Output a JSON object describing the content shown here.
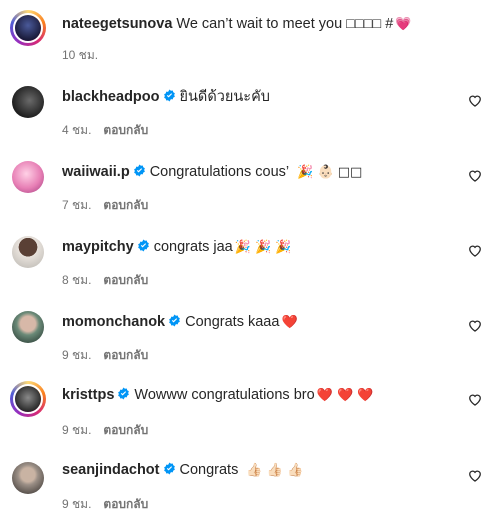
{
  "comments": [
    {
      "username": "nateegetsunova",
      "verified": false,
      "text": "We can’t wait to meet you □□□□ #",
      "emoji": "💗",
      "time": "10 ชม.",
      "reply": "",
      "heart": false,
      "avatar_color": "#1a1b3a"
    },
    {
      "username": "blackheadpoo",
      "verified": true,
      "text": "ยินดีด้วยนะคับ",
      "emoji": "",
      "time": "4 ชม.",
      "reply": "ตอบกลับ",
      "heart": true,
      "avatar_color": "#2b2b2b"
    },
    {
      "username": "waiiwaii.p",
      "verified": true,
      "text": "Congratulations cous’",
      "emoji": "🎉 👶🏻 □□",
      "time": "7 ชม.",
      "reply": "ตอบกลับ",
      "heart": true,
      "avatar_color": "#e77fb5"
    },
    {
      "username": "maypitchy",
      "verified": true,
      "text": "congrats jaa",
      "emoji": "🎉 🎉 🎉",
      "time": "8 ชม.",
      "reply": "ตอบกลับ",
      "heart": true,
      "avatar_color": "#c7c3bd"
    },
    {
      "username": "momonchanok",
      "verified": true,
      "text": "Congrats kaaa",
      "emoji": "❤️",
      "time": "9 ชม.",
      "reply": "ตอบกลับ",
      "heart": true,
      "avatar_color": "#4b6a5c"
    },
    {
      "username": "kristtps",
      "verified": true,
      "text": "Wowww congratulations bro",
      "emoji": "❤️ ❤️ ❤️",
      "time": "9 ชม.",
      "reply": "ตอบกลับ",
      "heart": true,
      "avatar_color": "#3a3a3a"
    },
    {
      "username": "seanjindachot",
      "verified": true,
      "text": "Congrats",
      "emoji": "👍🏻 👍🏻 👍🏻",
      "time": "9 ชม.",
      "reply": "ตอบกลับ",
      "heart": true,
      "avatar_color": "#9b8f86"
    }
  ],
  "colors": {
    "verified": "#0095f6",
    "meta": "#737373",
    "text": "#262626"
  }
}
